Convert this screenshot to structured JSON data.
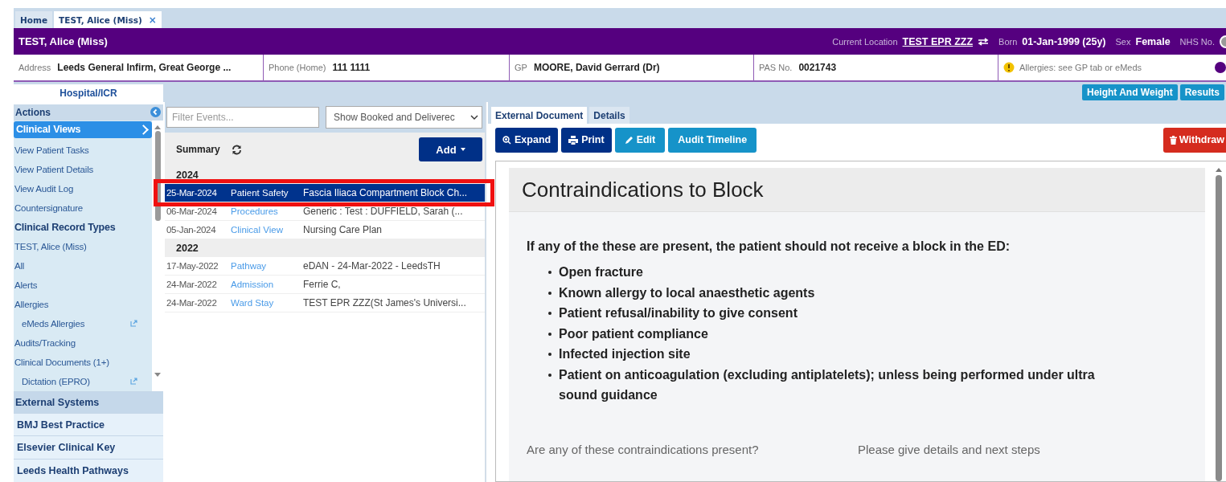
{
  "tabs": [
    {
      "label": "Home",
      "selected": false,
      "closable": false
    },
    {
      "label": "TEST, Alice (Miss)",
      "selected": true,
      "closable": true
    }
  ],
  "close_glyph": "×",
  "patient_banner": {
    "name": "TEST, Alice (Miss)",
    "location_label": "Current Location",
    "location": "TEST EPR ZZZ",
    "born_label": "Born",
    "born": "01-Jan-1999 (25y)",
    "sex_label": "Sex",
    "sex": "Female",
    "nhs_label": "NHS No."
  },
  "details": [
    {
      "label": "Address",
      "value": "Leeds General Infirm, Great George ..."
    },
    {
      "label": "Phone (Home)",
      "value": "111 1111"
    },
    {
      "label": "GP",
      "value": "MOORE, David Gerrard (Dr)"
    },
    {
      "label": "PAS No.",
      "value": "0021743"
    }
  ],
  "allergies": "Allergies: see GP tab or eMeds",
  "section_tab": "Hospital/ICR",
  "top_buttons": [
    "Height And Weight",
    "Results"
  ],
  "sidebar": {
    "title": "Actions",
    "items": [
      {
        "kind": "link",
        "label": "Clinical Views",
        "selected": true
      },
      {
        "kind": "link",
        "label": "View Patient Tasks",
        "selected": false
      },
      {
        "kind": "link",
        "label": "View Patient Details",
        "selected": false
      },
      {
        "kind": "link",
        "label": "View Audit Log",
        "selected": false
      },
      {
        "kind": "link",
        "label": "Countersignature",
        "selected": false
      },
      {
        "kind": "heading",
        "label": "Clinical Record Types"
      },
      {
        "kind": "link",
        "label": "TEST, Alice (Miss)",
        "selected": false
      },
      {
        "kind": "link",
        "label": "All",
        "selected": false
      },
      {
        "kind": "link",
        "label": "Alerts",
        "selected": false
      },
      {
        "kind": "link",
        "label": "Allergies",
        "selected": false
      },
      {
        "kind": "external",
        "label": "eMeds Allergies",
        "selected": false
      },
      {
        "kind": "link",
        "label": "Audits/Tracking",
        "selected": false
      },
      {
        "kind": "link",
        "label": "Clinical Documents (1+)",
        "selected": false
      },
      {
        "kind": "external",
        "label": "Dictation (EPRO)",
        "selected": false
      }
    ],
    "sections": [
      {
        "label": "External Systems",
        "kind": "group"
      },
      {
        "label": "BMJ Best Practice",
        "kind": "link"
      },
      {
        "label": "Elsevier Clinical Key",
        "kind": "link"
      },
      {
        "label": "Leeds Health Pathways",
        "kind": "link"
      }
    ]
  },
  "events": {
    "filter_placeholder": "Filter Events...",
    "show_filter": "Show Booked and Deliverec",
    "summary": "Summary",
    "add_button": "Add",
    "groups": [
      {
        "year": "2024",
        "rows": [
          {
            "date": "25-Mar-2024",
            "type": "Patient Safety",
            "description": "Fascia Iliaca Compartment Block Ch...",
            "selected": true,
            "highlighted": true
          },
          {
            "date": "06-Mar-2024",
            "type": "Procedures",
            "description": "Generic : Test : DUFFIELD, Sarah (...",
            "selected": false,
            "highlighted": false
          },
          {
            "date": "05-Jan-2024",
            "type": "Clinical View",
            "description": "Nursing Care Plan",
            "selected": false,
            "highlighted": false
          }
        ]
      },
      {
        "year": "2022",
        "rows": [
          {
            "date": "17-May-2022",
            "type": "Pathway",
            "description": "eDAN - 24-Mar-2022 - LeedsTH",
            "selected": false,
            "highlighted": false
          },
          {
            "date": "24-Mar-2022",
            "type": "Admission",
            "description": "Ferrie C,",
            "selected": false,
            "highlighted": false
          },
          {
            "date": "24-Mar-2022",
            "type": "Ward Stay",
            "description": "TEST EPR ZZZ(St James's Universi...",
            "selected": false,
            "highlighted": false
          }
        ]
      }
    ]
  },
  "document": {
    "tabs": [
      {
        "label": "External Document",
        "selected": true
      },
      {
        "label": "Details",
        "selected": false
      }
    ],
    "toolbar": [
      {
        "label": "Expand",
        "kind": "expand"
      },
      {
        "label": "Print",
        "kind": "print"
      },
      {
        "label": "Edit",
        "kind": "edit"
      },
      {
        "label": "Audit Timeline",
        "kind": "plain"
      }
    ],
    "withdraw": "Withdraw",
    "title": "Contraindications to Block",
    "intro": "If any of the these are present, the patient should not receive a block in the ED:",
    "bullets": [
      "Open fracture",
      "Known allergy to local anaesthetic agents",
      "Patient refusal/inability to give consent",
      "Poor patient compliance",
      "Infected injection site",
      "Patient on anticoagulation (excluding antiplatelets); unless being performed under ultra sound guidance"
    ],
    "questions": [
      "Are any of these contraindications present?",
      "Please give details and next steps"
    ]
  }
}
